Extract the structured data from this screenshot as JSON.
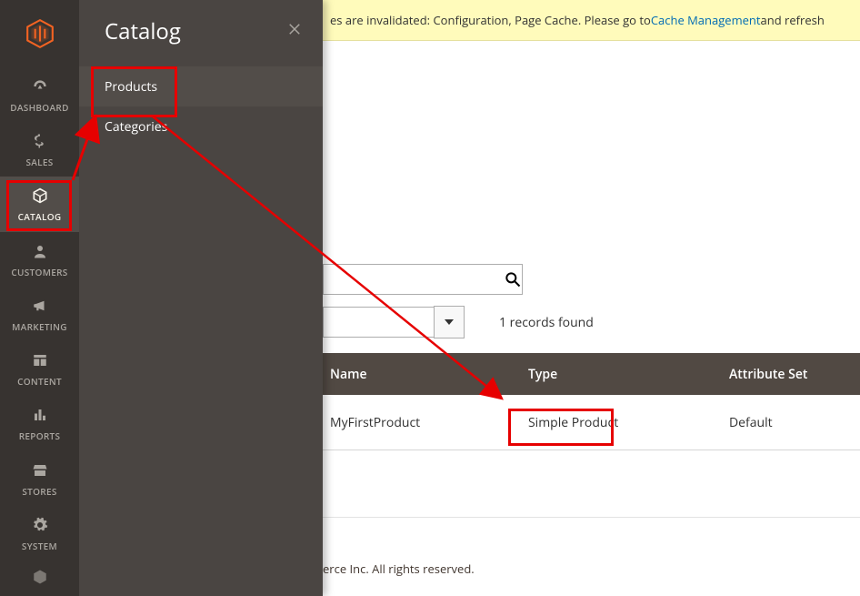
{
  "sidebar": {
    "items": [
      {
        "label": "DASHBOARD"
      },
      {
        "label": "SALES"
      },
      {
        "label": "CATALOG"
      },
      {
        "label": "CUSTOMERS"
      },
      {
        "label": "MARKETING"
      },
      {
        "label": "CONTENT"
      },
      {
        "label": "REPORTS"
      },
      {
        "label": "STORES"
      },
      {
        "label": "SYSTEM"
      }
    ]
  },
  "flyout": {
    "title": "Catalog",
    "items": [
      {
        "label": "Products"
      },
      {
        "label": "Categories"
      }
    ]
  },
  "warning": {
    "text_part1": "es are invalidated: Configuration, Page Cache. Please go to ",
    "link": "Cache Management",
    "text_part2": " and refresh"
  },
  "toolbar": {
    "records_found": "1 records found"
  },
  "table": {
    "headers": {
      "name": "Name",
      "type": "Type",
      "attr": "Attribute Set"
    },
    "rows": [
      {
        "name": "MyFirstProduct",
        "type": "Simple Product",
        "attr": "Default"
      }
    ]
  },
  "footer": {
    "text": "erce Inc. All rights reserved."
  }
}
